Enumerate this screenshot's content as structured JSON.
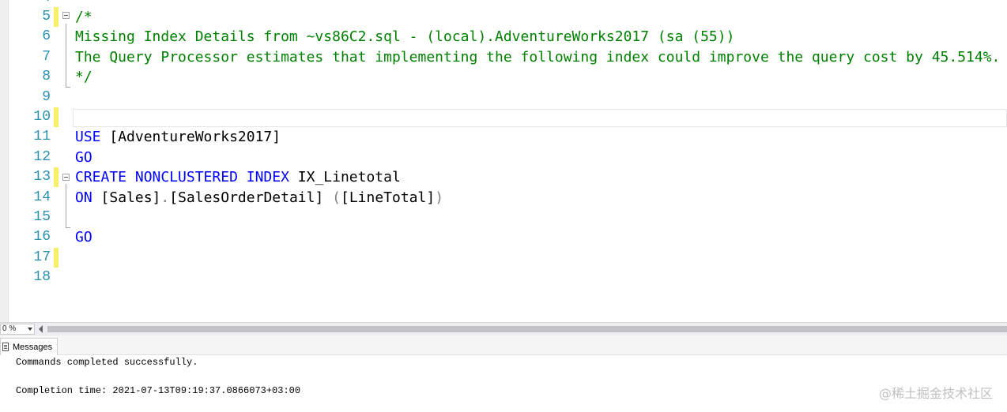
{
  "editor": {
    "partial_top_line": "4",
    "lines": [
      {
        "n": "5",
        "parts": [
          {
            "t": "/*",
            "c": "cm"
          }
        ],
        "mark": true
      },
      {
        "n": "6",
        "parts": [
          {
            "t": "Missing Index Details from ~vs86C2.sql - (local).AdventureWorks2017 (sa (55))",
            "c": "cm"
          }
        ],
        "mark": false
      },
      {
        "n": "7",
        "parts": [
          {
            "t": "The Query Processor estimates that implementing the following index could improve the query cost by 45.514%.",
            "c": "cm"
          }
        ],
        "mark": false
      },
      {
        "n": "8",
        "parts": [
          {
            "t": "*/",
            "c": "cm"
          }
        ],
        "mark": false
      },
      {
        "n": "9",
        "parts": [],
        "mark": false
      },
      {
        "n": "10",
        "parts": [],
        "mark": true
      },
      {
        "n": "11",
        "parts": [
          {
            "t": "USE",
            "c": "kw"
          },
          {
            "t": " [AdventureWorks2017]",
            "c": ""
          }
        ],
        "mark": false
      },
      {
        "n": "12",
        "parts": [
          {
            "t": "GO",
            "c": "kw"
          }
        ],
        "mark": false
      },
      {
        "n": "13",
        "parts": [
          {
            "t": "CREATE NONCLUSTERED INDEX",
            "c": "kw"
          },
          {
            "t": " IX_Linetotal",
            "c": ""
          }
        ],
        "mark": true
      },
      {
        "n": "14",
        "parts": [
          {
            "t": "ON",
            "c": "kw"
          },
          {
            "t": " [Sales]",
            "c": ""
          },
          {
            "t": ".",
            "c": "gr"
          },
          {
            "t": "[SalesOrderDetail] ",
            "c": ""
          },
          {
            "t": "(",
            "c": "gr"
          },
          {
            "t": "[LineTotal]",
            "c": ""
          },
          {
            "t": ")",
            "c": "gr"
          }
        ],
        "mark": false
      },
      {
        "n": "15",
        "parts": [],
        "mark": false
      },
      {
        "n": "16",
        "parts": [
          {
            "t": "GO",
            "c": "kw"
          }
        ],
        "mark": false
      },
      {
        "n": "17",
        "parts": [],
        "mark": true
      },
      {
        "n": "18",
        "parts": [],
        "mark": false
      }
    ]
  },
  "statusbar": {
    "zoom": "0 %"
  },
  "messages": {
    "tab_label": "Messages",
    "line1": "Commands completed successfully.",
    "line2": "Completion time: 2021-07-13T09:19:37.0866073+03:00"
  },
  "watermark": "@稀土掘金技术社区",
  "colors": {
    "keyword": "#0000ff",
    "comment": "#008000",
    "line_number": "#2b91af",
    "change_mark": "#f7ee6a"
  }
}
